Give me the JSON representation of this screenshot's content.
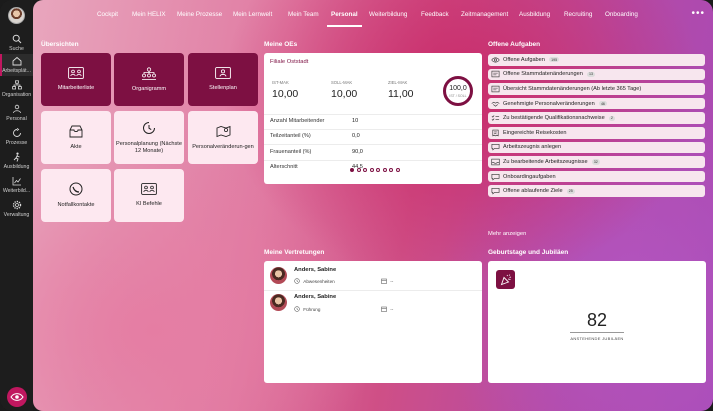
{
  "sidebar": {
    "items": [
      {
        "label": "Suche",
        "icon": "search-icon"
      },
      {
        "label": "Arbeitsplät...",
        "icon": "home-icon"
      },
      {
        "label": "Organisation",
        "icon": "org-icon"
      },
      {
        "label": "Personal",
        "icon": "people-icon"
      },
      {
        "label": "Prozesse",
        "icon": "process-icon"
      },
      {
        "label": "Ausbildung",
        "icon": "training-icon"
      },
      {
        "label": "Weiterbild...",
        "icon": "chart-icon"
      },
      {
        "label": "Verwaltung",
        "icon": "gear-icon"
      }
    ]
  },
  "nav": {
    "items": [
      "Cockpit",
      "Mein HELIX",
      "Meine Prozesse",
      "Mein Lernwelt",
      "Mein Team",
      "Personal",
      "Weiterbildung",
      "Feedback",
      "Zeitmanagement",
      "Ausbildung",
      "Recruiting",
      "Onboarding"
    ],
    "active": "Personal",
    "more": "•••"
  },
  "overview": {
    "title": "Übersichten",
    "tiles": [
      {
        "label": "Mitarbeiterliste",
        "icon": "employee-list-icon"
      },
      {
        "label": "Organigramm",
        "icon": "org-chart-icon"
      },
      {
        "label": "Stellenplan",
        "icon": "position-plan-icon"
      },
      {
        "label": "Akte",
        "icon": "file-box-icon"
      },
      {
        "label": "Personalplanung (Nächste 12 Monate)",
        "icon": "planning-icon"
      },
      {
        "label": "Personalveränderun-gen",
        "icon": "map-icon"
      },
      {
        "label": "Notfallkontakte",
        "icon": "emergency-icon"
      },
      {
        "label": "KI Befehle",
        "icon": "ai-icon"
      }
    ]
  },
  "oes": {
    "title": "Meine OEs",
    "subtitle": "Filiale Oststadt",
    "kpis": [
      {
        "label": "IST-MAK",
        "value": "10,00"
      },
      {
        "label": "SOLL-MAK",
        "value": "10,00"
      },
      {
        "label": "ZIEL-MAK",
        "value": "11,00"
      }
    ],
    "ring": {
      "value": "100,0",
      "label": "IST / SOLL",
      "fraction": 1.0
    },
    "rows": [
      {
        "label": "Anzahl Mitarbeitender",
        "value": "10"
      },
      {
        "label": "Teilzeitanteil (%)",
        "value": "0,0"
      },
      {
        "label": "Frauenanteil (%)",
        "value": "90,0"
      },
      {
        "label": "Alterschnitt",
        "value": "44,5"
      }
    ],
    "pager": {
      "total": 8,
      "current": 1
    }
  },
  "tasks": {
    "title": "Offene Aufgaben",
    "items": [
      {
        "label": "Offene Aufgaben",
        "badge": "195",
        "icon": "eye-icon"
      },
      {
        "label": "Offene Stammdatenänderungen",
        "badge": "13",
        "icon": "form-icon"
      },
      {
        "label": "Übersicht Stammdatenänderungen (Ab letzte 365 Tage)",
        "badge": "",
        "icon": "form-icon"
      },
      {
        "label": "Genehmigte Personalveränderungen",
        "badge": "46",
        "icon": "handshake-icon"
      },
      {
        "label": "Zu bestätigende Qualifikationsnachweise",
        "badge": "2",
        "icon": "check-list-icon"
      },
      {
        "label": "Eingereichte Reisekosten",
        "badge": "",
        "icon": "receipt-icon"
      },
      {
        "label": "Arbeitszeugnis anlegen",
        "badge": "",
        "icon": "chat-icon"
      },
      {
        "label": "Zu bearbeitende Arbeitszeugnisse",
        "badge": "32",
        "icon": "inbox-icon"
      },
      {
        "label": "Onboardingaufgaben",
        "badge": "",
        "icon": "chat-icon"
      },
      {
        "label": "Offene ablaufende Ziele",
        "badge": "25",
        "icon": "chat-icon"
      }
    ],
    "more": "Mehr anzeigen"
  },
  "deputies": {
    "title": "Meine Vertretungen",
    "items": [
      {
        "name": "Anders, Sabine",
        "role": "Abwesenheiten",
        "date": "--"
      },
      {
        "name": "Anders, Sabine",
        "role": "Führung",
        "date": "--"
      }
    ]
  },
  "birthdays": {
    "title": "Geburtstage und Jubiläen",
    "count": "82",
    "label": "ANSTEHENDE JUBILÄEN"
  },
  "colors": {
    "accent": "#7d1042",
    "brand": "#c0175f"
  }
}
